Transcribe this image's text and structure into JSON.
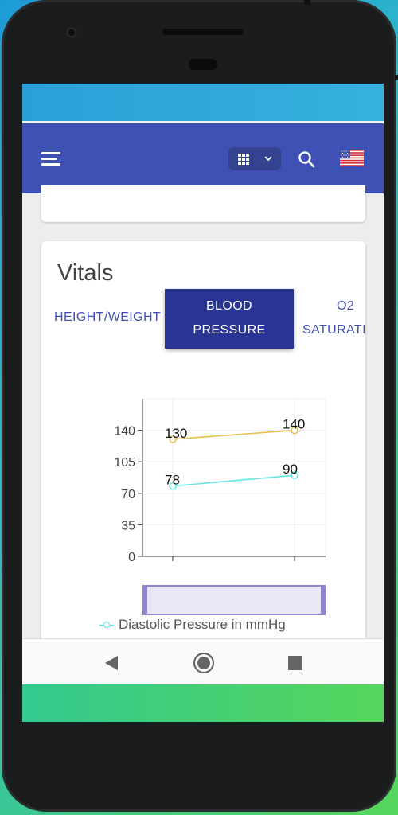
{
  "colors": {
    "app_bar": "#3f51b5",
    "tab_active": "#283593",
    "systolic_line": "#e6c04a",
    "diastolic_line": "#64e3e3"
  },
  "header": {
    "menu_icon": "hamburger-menu-icon",
    "grid_select_icon": "apps-grid-icon",
    "search_icon": "search-icon",
    "language_flag": "us-flag-icon"
  },
  "vitals": {
    "title": "Vitals",
    "tabs": [
      {
        "label": "HEIGHT/WEIGHT",
        "active": false
      },
      {
        "label_line1": "BLOOD",
        "label_line2": "PRESSURE",
        "active": true
      },
      {
        "label_line1": "O2",
        "label_line2": "SATURATION",
        "active": false
      }
    ]
  },
  "chart_data": {
    "type": "line",
    "x": [
      "1",
      "2"
    ],
    "yticks": [
      "0",
      "35",
      "70",
      "105",
      "140"
    ],
    "ylim": [
      0,
      175
    ],
    "grid": true,
    "series": [
      {
        "values": [
          130,
          140
        ],
        "color": "#e6c04a",
        "labels": [
          "130",
          "140"
        ]
      },
      {
        "name": "Diastolic Pressure in mmHg",
        "values": [
          78,
          90
        ],
        "color": "#64e3e3",
        "labels": [
          "78",
          "90"
        ]
      }
    ],
    "legend": "Diastolic Pressure in mmHg",
    "legend_position": "bottom"
  },
  "nav": {
    "back_icon": "back-triangle-icon",
    "home_icon": "home-circle-icon",
    "recents_icon": "recents-square-icon"
  }
}
